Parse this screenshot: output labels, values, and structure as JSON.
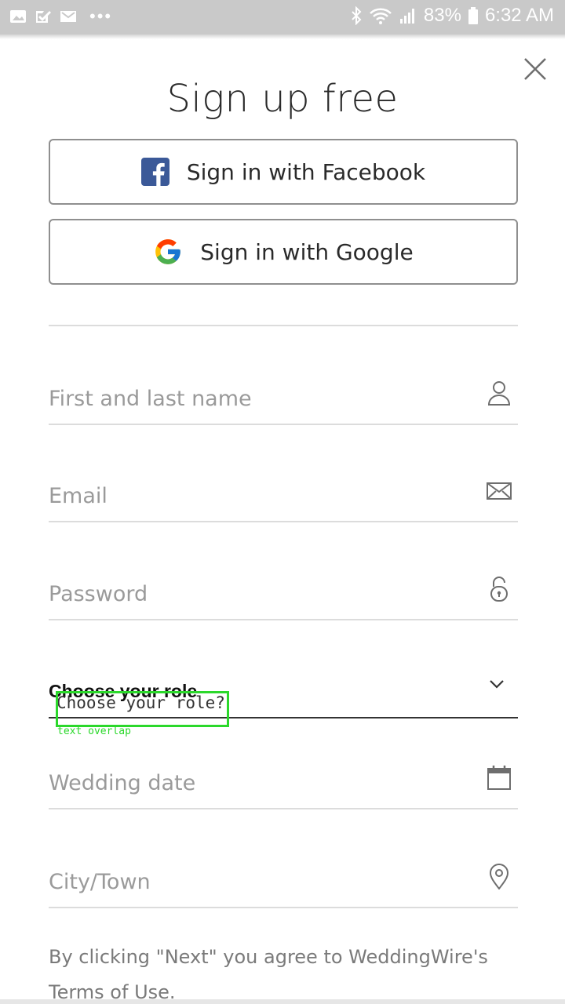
{
  "status_bar": {
    "battery": "83%",
    "time": "6:32 AM",
    "more": "•••"
  },
  "header": {
    "title": "Sign up free"
  },
  "social": {
    "facebook_label": "Sign in with Facebook",
    "google_label": "Sign in with Google"
  },
  "form": {
    "name_placeholder": "First and last name",
    "email_placeholder": "Email",
    "password_placeholder": "Password",
    "role_label": "Choose your role",
    "role_overlap_text": "Choose your role?",
    "overlap_note": "text overlap",
    "date_placeholder": "Wedding date",
    "city_placeholder": "City/Town"
  },
  "legal": {
    "text": "By clicking \"Next\" you agree to WeddingWire's",
    "link": "Terms of Use",
    "suffix": "."
  },
  "colors": {
    "facebook_blue": "#3b5998",
    "status_bar_bg": "#c9c9c9",
    "overlap_highlight": "#2bd82b"
  }
}
